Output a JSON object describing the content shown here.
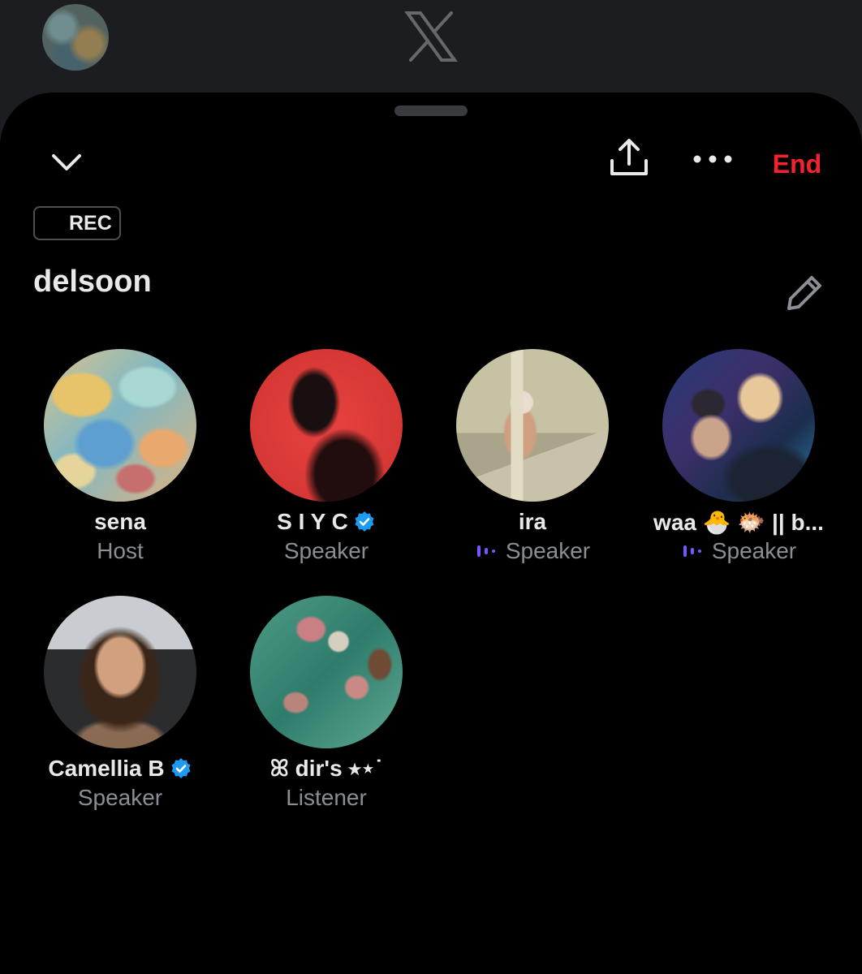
{
  "topbar": {
    "avatar_icon": "account-avatar",
    "logo_icon": "x-logo-icon"
  },
  "toolbar": {
    "collapse_icon": "chevron-down-icon",
    "share_icon": "share-upload-icon",
    "more_icon": "more-dots-icon",
    "end_label": "End",
    "end_color": "#f4212e"
  },
  "space": {
    "rec_label": "REC",
    "title": "delsoon",
    "edit_icon": "pencil-icon"
  },
  "participants": [
    {
      "name": "sena",
      "role": "Host",
      "verified": false,
      "speaking": false
    },
    {
      "name": "S I Y C",
      "role": "Speaker",
      "verified": true,
      "speaking": false
    },
    {
      "name": "ira",
      "role": "Speaker",
      "verified": false,
      "speaking": true
    },
    {
      "name": "waa 🐣 🐡 || b...",
      "role": "Speaker",
      "verified": false,
      "speaking": true
    },
    {
      "name": "Camellia B",
      "role": "Speaker",
      "verified": true,
      "speaking": false
    },
    {
      "name": "ꕤ dir's ⭑⋆˙",
      "role": "Listener",
      "verified": false,
      "speaking": false
    }
  ],
  "colors": {
    "verified": "#1d9bf0",
    "speaking": "#7856ff",
    "muted_text": "#8b8e93"
  }
}
